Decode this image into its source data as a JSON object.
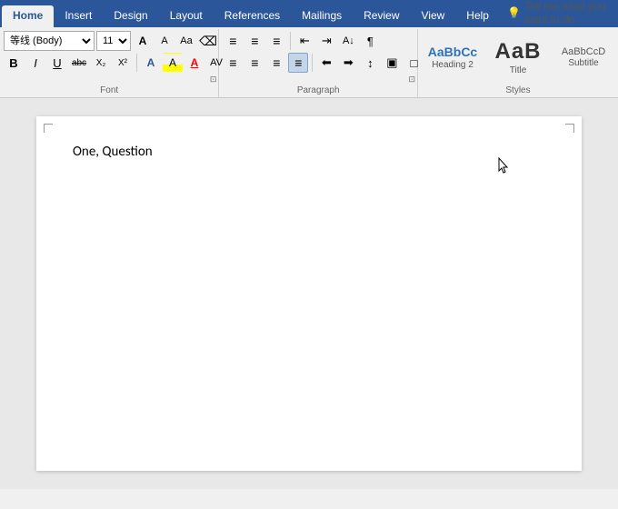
{
  "tabs": [
    {
      "id": "home",
      "label": "Home",
      "active": true
    },
    {
      "id": "insert",
      "label": "Insert",
      "active": false
    },
    {
      "id": "design",
      "label": "Design",
      "active": false
    },
    {
      "id": "layout",
      "label": "Layout",
      "active": false
    },
    {
      "id": "references",
      "label": "References",
      "active": false
    },
    {
      "id": "mailings",
      "label": "Mailings",
      "active": false
    },
    {
      "id": "review",
      "label": "Review",
      "active": false
    },
    {
      "id": "view",
      "label": "View",
      "active": false
    },
    {
      "id": "help",
      "label": "Help",
      "active": false
    }
  ],
  "font": {
    "name": "等线 (Body)",
    "size": "11",
    "grow_label": "A",
    "shrink_label": "A",
    "bold": "B",
    "italic": "I",
    "underline": "U",
    "strikethrough": "abc",
    "subscript": "X₂",
    "superscript": "X²",
    "clear_format": "A",
    "font_color": "A",
    "highlight": "A",
    "text_effects": "A",
    "char_spacing": "AV",
    "group_label": "Font",
    "expand_icon": "⊡"
  },
  "paragraph": {
    "bullets": "≡",
    "numbering": "≡",
    "multilevel": "≡",
    "decrease_indent": "←",
    "increase_indent": "→",
    "sort": "A↓",
    "show_marks": "¶",
    "align_left": "≡",
    "align_center": "≡",
    "align_right": "≡",
    "justify": "≡",
    "left_indent": "←",
    "right_indent": "→",
    "line_spacing": "↕",
    "shading": "▣",
    "borders": "□",
    "group_label": "Paragraph",
    "expand_icon": "⊡"
  },
  "styles": [
    {
      "id": "heading2",
      "preview": "AaBbCc",
      "label": "Heading 2",
      "style": "heading2"
    },
    {
      "id": "title",
      "preview": "AaB",
      "label": "Title",
      "style": "title"
    },
    {
      "id": "subtitle",
      "preview": "AaBbCcD",
      "label": "Subtitle",
      "style": "subtitle"
    }
  ],
  "styles_group_label": "Styles",
  "tellme_placeholder": "Tell me what you want to do",
  "document": {
    "content": "One, Question"
  }
}
